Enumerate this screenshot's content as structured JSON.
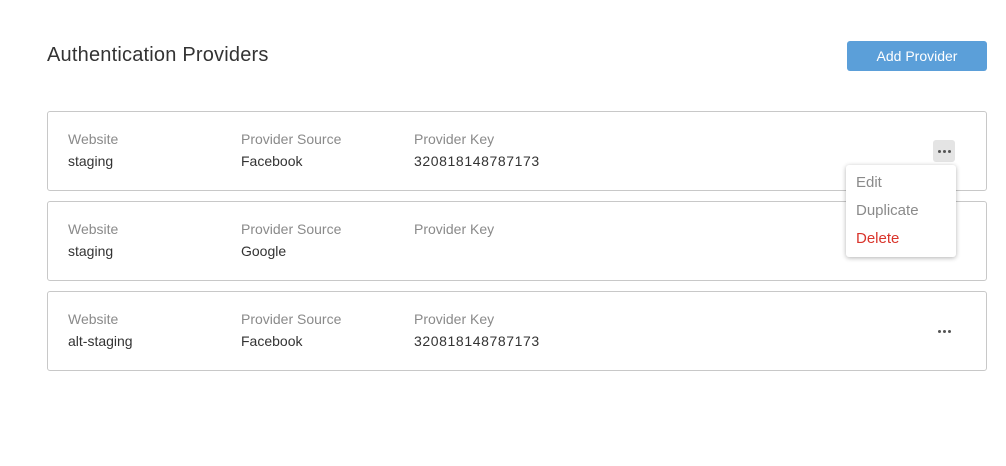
{
  "header": {
    "title": "Authentication Providers",
    "add_button_label": "Add Provider"
  },
  "labels": {
    "website": "Website",
    "provider_source": "Provider Source",
    "provider_key": "Provider Key"
  },
  "providers": [
    {
      "website": "staging",
      "provider_source": "Facebook",
      "provider_key": "320818148787173",
      "menu_open": true
    },
    {
      "website": "staging",
      "provider_source": "Google",
      "provider_key": "",
      "menu_open": false
    },
    {
      "website": "alt-staging",
      "provider_source": "Facebook",
      "provider_key": "320818148787173",
      "menu_open": false
    }
  ],
  "menu": {
    "items": [
      {
        "label": "Edit",
        "variant": "default"
      },
      {
        "label": "Duplicate",
        "variant": "default"
      },
      {
        "label": "Delete",
        "variant": "danger"
      }
    ]
  },
  "colors": {
    "accent": "#5b9fd9",
    "danger": "#d9342b",
    "label_gray": "#8a8a8a",
    "border": "#c8c8c8"
  },
  "icons": {
    "more": "more-horizontal-icon"
  }
}
